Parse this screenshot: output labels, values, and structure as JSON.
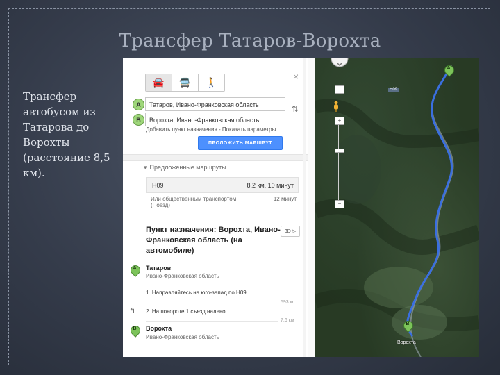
{
  "slide": {
    "title": "Трансфер Татаров-Ворохта",
    "body": "Трансфер автобусом из Татарова до Ворохты (расстояние 8,5 км)."
  },
  "panel": {
    "mode_tabs": [
      {
        "icon": "car-icon",
        "glyph": "🚘"
      },
      {
        "icon": "bus-icon",
        "glyph": "🚍"
      },
      {
        "icon": "walk-icon",
        "glyph": "🚶"
      }
    ],
    "close": "×",
    "start": {
      "letter": "A",
      "value": "Татаров, Ивано-Франковская область"
    },
    "end": {
      "letter": "B",
      "value": "Ворохта, Ивано-Франковская область"
    },
    "swap": "⇅",
    "dest_links": "Добавить пункт назначения - Показать параметры",
    "route_button": "ПРОЛОЖИТЬ МАРШРУТ",
    "suggested_header": "Предложенные маршруты",
    "route": {
      "name": "Н09",
      "distance": "8,2 км, 10 минут"
    },
    "transit": {
      "line1": "Или общественным транспортом",
      "line2": "(Поезд)",
      "time": "12 минут"
    },
    "destination_title": "Пункт назначения: Ворохта, Ивано-Франковская область (на автомобиле)",
    "btn_3d": "3D ▷",
    "steps": {
      "start_place": "Татаров",
      "start_region": "Ивано-Франковская область",
      "step1": "1. Направляйтесь на юго-запад по Н09",
      "step1_dist": "593 м",
      "step2": "2. На повороте 1 съезд налево",
      "step2_dist": "7,6 км",
      "end_place": "Ворохта",
      "end_region": "Ивано-Франковская область"
    }
  },
  "map": {
    "road_label": "H09",
    "town": "Ворохта",
    "marker_a": "A",
    "marker_b": "B",
    "zoom_in": "+",
    "zoom_out": "−"
  },
  "colors": {
    "route": "#3a6fe0",
    "marker": "#7cc35a",
    "button": "#4d90fe"
  }
}
